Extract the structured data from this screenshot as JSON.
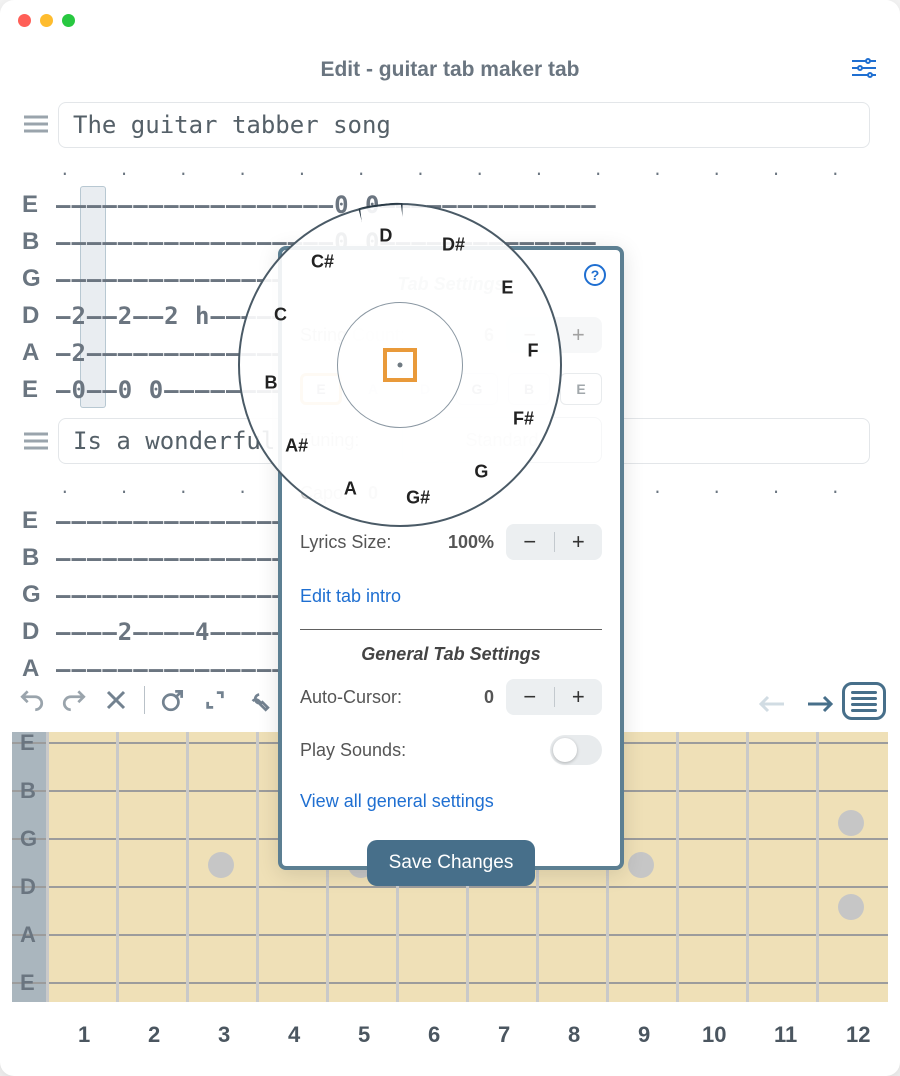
{
  "header": {
    "title": "Edit - guitar tab maker tab"
  },
  "song": {
    "title1": "The guitar tabber song",
    "title2": "Is a wonderful"
  },
  "strings": [
    "E",
    "B",
    "G",
    "D",
    "A",
    "E"
  ],
  "tab1": {
    "E": "——————————————————0 0——————————————",
    "B": "——————————————————0 0——————————————",
    "G": "———————————————————————————————————",
    "D": "—2——2——2 h————————————————————————",
    "A": "—2—————————————————————————————————",
    "E2": "—0——0 0————————————————————————E——"
  },
  "tab2": {
    "E": "———————————————————————————————————",
    "B": "———————————————————————————————————",
    "G": "———————————————————————————————————",
    "D": "————2————4————————————————————————",
    "A": "———————————————————————————————————"
  },
  "panel": {
    "heading": "Tab Settings",
    "string_count_label": "String Count:",
    "string_count_value": "6",
    "tuning_label": "Tuning:",
    "tuning_value": "Standard",
    "tuning_buttons": [
      "E",
      "A",
      "D",
      "G",
      "B",
      "E"
    ],
    "active_tuning_index": 0,
    "capo_label": "Capo:",
    "capo_value": "0",
    "lyrics_label": "Lyrics Size:",
    "lyrics_value": "100%",
    "edit_intro": "Edit tab intro",
    "general_heading": "General Tab Settings",
    "auto_cursor_label": "Auto-Cursor:",
    "auto_cursor_value": "0",
    "play_sounds_label": "Play Sounds:",
    "view_all": "View all general settings",
    "save": "Save Changes"
  },
  "wheel": {
    "notes": [
      "D",
      "D#",
      "E",
      "F",
      "F#",
      "G",
      "G#",
      "A",
      "A#",
      "B",
      "C",
      "C#"
    ],
    "selected": "D"
  },
  "fretboard": {
    "open_labels": [
      "E",
      "B",
      "G",
      "D",
      "A",
      "E"
    ],
    "fret_numbers": [
      "1",
      "2",
      "3",
      "4",
      "5",
      "6",
      "7",
      "8",
      "9",
      "10",
      "11",
      "12"
    ]
  },
  "toolbar": {
    "undo": "undo",
    "redo": "redo",
    "delete": "x",
    "external": "ext",
    "fullscreen": "fs",
    "wrench": "wr"
  }
}
